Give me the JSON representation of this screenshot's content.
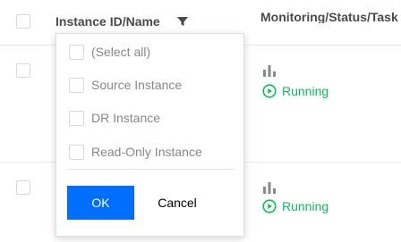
{
  "header": {
    "instance_col": "Instance ID/Name",
    "monitor_col": "Monitoring/Status/Task",
    "filter_icon": "filter-icon"
  },
  "rows": [
    {
      "status": "Running",
      "status_icon": "play-circle-icon",
      "monitor_icon": "bar-chart-icon"
    },
    {
      "status": "Running",
      "status_icon": "play-circle-icon",
      "monitor_icon": "bar-chart-icon"
    }
  ],
  "filter_dropdown": {
    "options": [
      "(Select all)",
      "Source Instance",
      "DR Instance",
      "Read-Only Instance"
    ],
    "ok_label": "OK",
    "cancel_label": "Cancel"
  },
  "colors": {
    "primary": "#006eff",
    "running": "#0abf5b",
    "header_text": "#4a4a4a",
    "option_text": "#888888"
  }
}
